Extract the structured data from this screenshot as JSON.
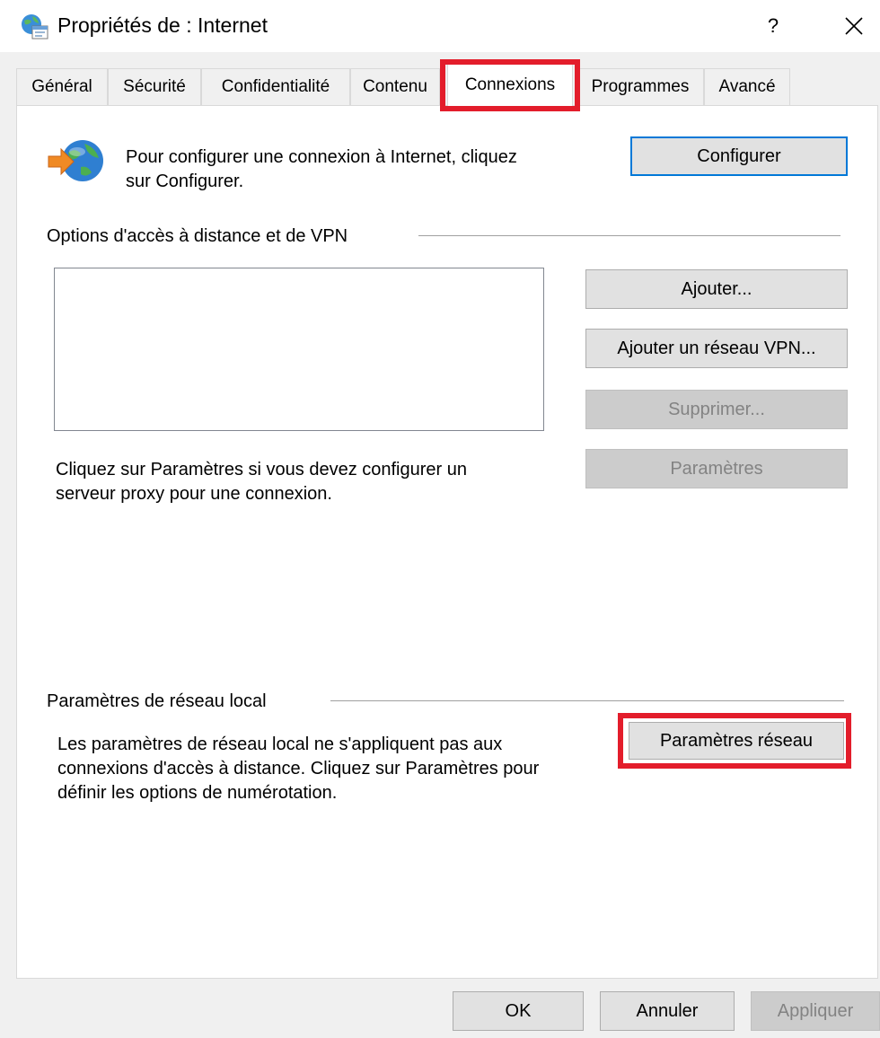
{
  "window": {
    "title": "Propriétés de : Internet",
    "help_label": "?",
    "close_icon": "close-icon",
    "app_icon": "internet-options-icon"
  },
  "tabs": [
    {
      "label": "Général",
      "active": false
    },
    {
      "label": "Sécurité",
      "active": false
    },
    {
      "label": "Confidentialité",
      "active": false
    },
    {
      "label": "Contenu",
      "active": false
    },
    {
      "label": "Connexions",
      "active": true
    },
    {
      "label": "Programmes",
      "active": false
    },
    {
      "label": "Avancé",
      "active": false
    }
  ],
  "setup": {
    "icon": "globe-connection-icon",
    "text_line1": "Pour configurer une connexion à Internet, cliquez",
    "text_line2": "sur Configurer.",
    "button": "Configurer"
  },
  "vpn_group": {
    "title": "Options d'accès à distance et de VPN",
    "buttons": {
      "add": "Ajouter...",
      "add_vpn": "Ajouter un réseau VPN...",
      "remove": "Supprimer...",
      "settings": "Paramètres"
    },
    "proxy_line1": "Cliquez sur Paramètres si vous devez configurer un",
    "proxy_line2": "serveur proxy pour une connexion."
  },
  "lan_group": {
    "title": "Paramètres de réseau local",
    "text_line1": "Les paramètres de réseau local ne s'appliquent pas aux",
    "text_line2": "connexions d'accès à distance. Cliquez sur Paramètres pour",
    "text_line3": "définir les options de numérotation.",
    "button": "Paramètres réseau"
  },
  "footer": {
    "ok": "OK",
    "cancel": "Annuler",
    "apply": "Appliquer"
  },
  "colors": {
    "highlight": "#e31d2b",
    "default_button_border": "#0078d7"
  }
}
